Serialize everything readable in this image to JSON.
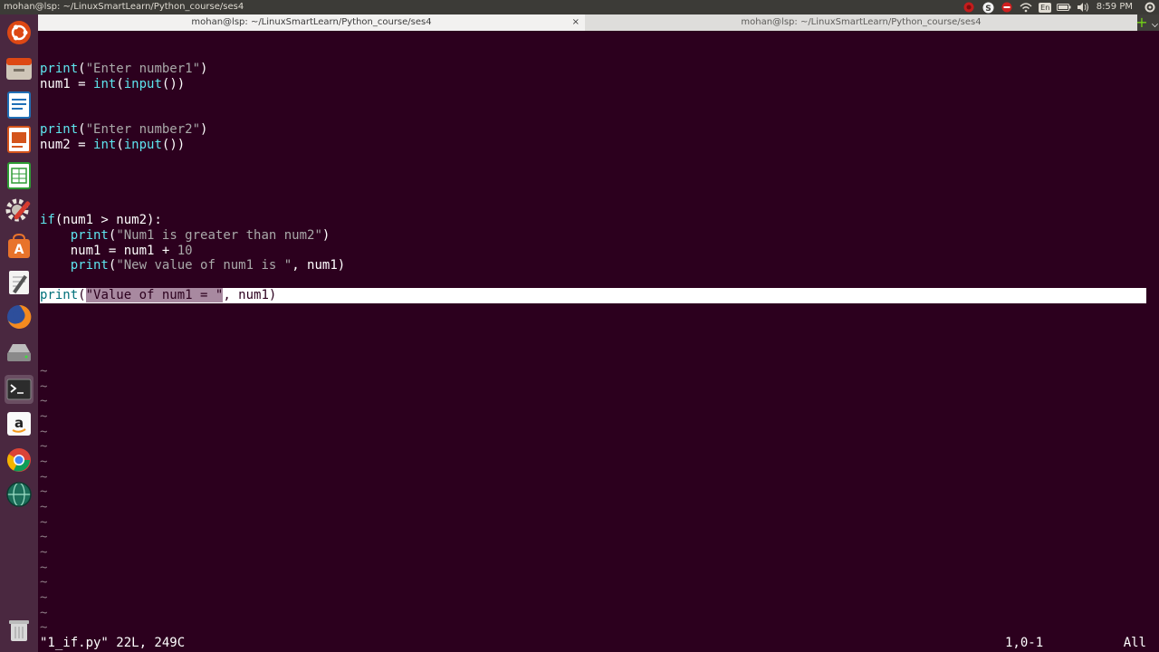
{
  "panel": {
    "window_title": "mohan@lsp: ~/LinuxSmartLearn/Python_course/ses4",
    "clock": "8:59 PM",
    "indicators": [
      "record-icon",
      "skype-icon",
      "stop-icon",
      "wifi-icon",
      "keyboard-layout-icon",
      "battery-icon",
      "volume-icon",
      "settings-icon"
    ],
    "keyboard_layout": "En"
  },
  "launcher": {
    "items": [
      "ubuntu-dash-icon",
      "file-manager-icon",
      "writer-icon",
      "impress-icon",
      "calc-icon",
      "system-settings-icon",
      "software-center-icon",
      "text-editor-icon",
      "firefox-icon",
      "drive-icon",
      "terminal-icon",
      "amazon-icon",
      "chrome-icon",
      "globe-icon",
      "trash-icon"
    ]
  },
  "tabs": [
    {
      "label": "mohan@lsp: ~/LinuxSmartLearn/Python_course/ses4",
      "close": "×",
      "active": true
    },
    {
      "label": "mohan@lsp: ~/LinuxSmartLearn/Python_course/ses4",
      "active": false
    }
  ],
  "new_tab_label": "+",
  "code": {
    "l1_kw": "print",
    "l1_a": "(",
    "l1_str": "\"Enter number1\"",
    "l1_b": ")",
    "l2_a": "num1 = ",
    "l2_kw1": "int",
    "l2_b": "(",
    "l2_kw2": "input",
    "l2_c": "())",
    "l3_kw": "print",
    "l3_a": "(",
    "l3_str": "\"Enter number2\"",
    "l3_b": ")",
    "l4_a": "num2 = ",
    "l4_kw1": "int",
    "l4_b": "(",
    "l4_kw2": "input",
    "l4_c": "())",
    "l5_kw": "if",
    "l5_a": "(num1 > num2):",
    "l6_indent": "    ",
    "l6_kw": "print",
    "l6_a": "(",
    "l6_str": "\"Num1 is greater than num2\"",
    "l6_b": ")",
    "l7_a": "    num1 = num1 + ",
    "l7_num": "10",
    "l8_indent": "    ",
    "l8_kw": "print",
    "l8_a": "(",
    "l8_str": "\"New value of num1 is \"",
    "l8_b": ", num1)",
    "l9_kw": "print",
    "l9_a": "(",
    "l9_str": "\"Value of num1 = \"",
    "l9_b": ", num1)"
  },
  "tilde_char": "~",
  "status": {
    "file_info": "\"1_if.py\" 22L, 249C",
    "cursor_pos": "1,0-1",
    "scroll": "All"
  }
}
